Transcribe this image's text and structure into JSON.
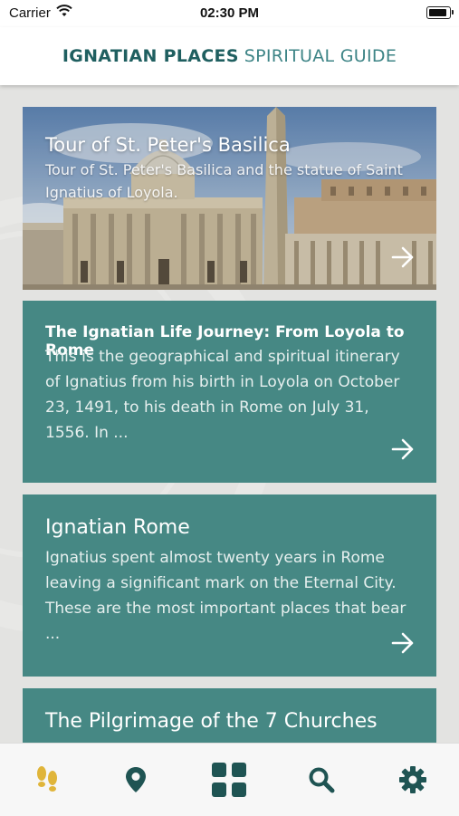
{
  "status_bar": {
    "carrier": "Carrier",
    "time": "02:30 PM",
    "battery_level": 0.9
  },
  "header": {
    "title_strong": "IGNATIAN PLACES",
    "title_light": "SPIRITUAL GUIDE"
  },
  "cards": [
    {
      "title": "Tour of St. Peter's Basilica",
      "description": "Tour of St. Peter's Basilica and the statue of Saint Ignatius of Loyola."
    },
    {
      "title": "The Ignatian Life Journey: From Loyola to Rome",
      "description": "This is the geographical and spiritual itinerary of Ignatius from his birth in Loyola on October 23, 1491, to his death in Rome on July 31, 1556. In ..."
    },
    {
      "title": "Ignatian Rome",
      "description": "Ignatius spent almost twenty years in Rome leaving a significant mark on the Eternal City. These are the most important places that bear ..."
    },
    {
      "title": "The Pilgrimage of the 7 Churches",
      "description": ""
    }
  ],
  "tabbar": {
    "items": [
      {
        "icon": "footprints-icon",
        "active": true
      },
      {
        "icon": "map-pin-icon",
        "active": false
      },
      {
        "icon": "grid-icon",
        "active": false
      },
      {
        "icon": "search-icon",
        "active": false
      },
      {
        "icon": "gear-icon",
        "active": false
      }
    ],
    "active_color": "#e0b53a",
    "inactive_color": "#1f5453"
  },
  "colors": {
    "card": "#468884",
    "brand": "#1f5f60",
    "background": "#e3e3e1"
  }
}
